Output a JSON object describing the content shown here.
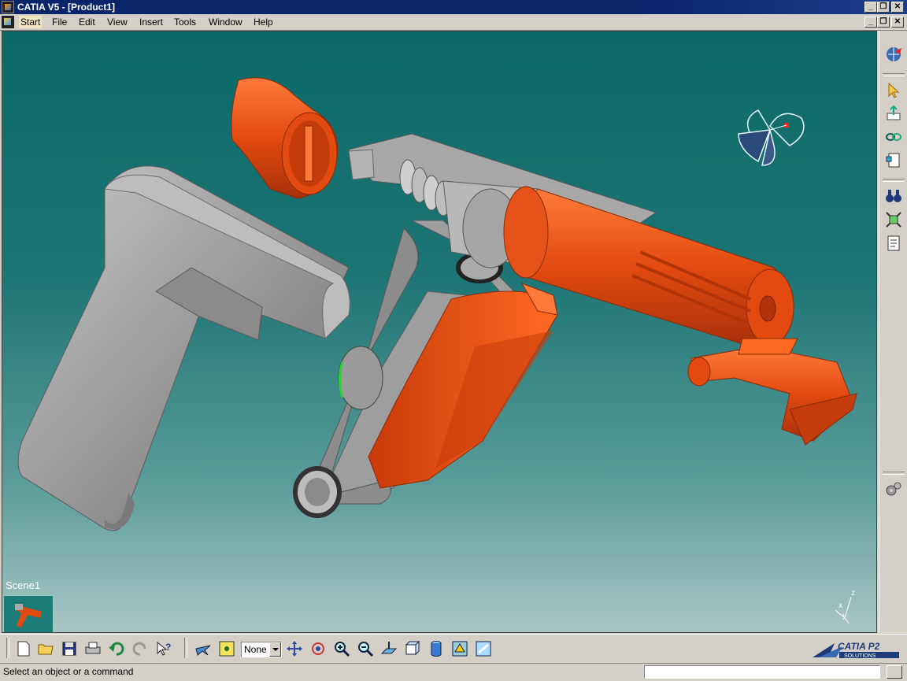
{
  "window": {
    "title": "CATIA V5 - [Product1]",
    "controls": [
      "_",
      "❐",
      "✕"
    ]
  },
  "menubar": {
    "items": [
      "Start",
      "File",
      "Edit",
      "View",
      "Insert",
      "Tools",
      "Window",
      "Help"
    ]
  },
  "viewport": {
    "scene_label": "Scene1",
    "axis_labels": {
      "x": "x",
      "y": "y",
      "z": "z"
    }
  },
  "bottom_toolbar": {
    "render_select_value": "None"
  },
  "brand": {
    "logo_text": "CATIA P2",
    "logo_subtext": "SOLUTIONS"
  },
  "statusbar": {
    "message": "Select an object or a command",
    "command_value": ""
  },
  "colors": {
    "title_bar": "#0a246a",
    "viewport_top": "#0c6a68",
    "viewport_bottom": "#a9c6c4",
    "part_orange": "#e24a10",
    "part_gray": "#9a9a9a",
    "chrome": "#d4d0c8"
  }
}
